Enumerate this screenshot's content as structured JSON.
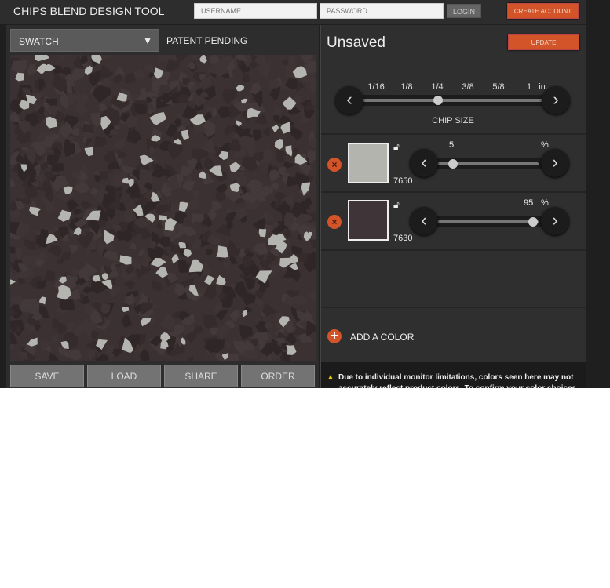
{
  "header": {
    "title": "CHIPS BLEND DESIGN TOOL",
    "username_placeholder": "USERNAME",
    "password_placeholder": "PASSWORD",
    "login": "LOGIN",
    "create_account": "CREATE ACCOUNT"
  },
  "left": {
    "view_select": "SWATCH",
    "patent": "PATENT PENDING",
    "buttons": [
      "SAVE",
      "LOAD",
      "SHARE",
      "ORDER"
    ]
  },
  "right": {
    "status": "Unsaved",
    "update": "UPDATE",
    "chip_size": {
      "label": "CHIP SIZE",
      "ticks": [
        "1/16",
        "1/8",
        "1/4",
        "3/8",
        "5/8",
        "1"
      ],
      "unit": "in.",
      "selected": "1/4"
    },
    "colors": [
      {
        "code": "7650",
        "percent": "5",
        "unit": "%",
        "swatch": "#b3b4ae"
      },
      {
        "code": "7630",
        "percent": "95",
        "unit": "%",
        "swatch": "#3f3437"
      }
    ],
    "add_color": "ADD A COLOR",
    "disclaimer": "Due to individual monitor limitations, colors seen here may not accurately reflect product colors. To confirm your color choices"
  },
  "colors": {
    "accent": "#d35428",
    "chip_light": "#b4b5b0",
    "chip_dark": "#3b3133"
  }
}
